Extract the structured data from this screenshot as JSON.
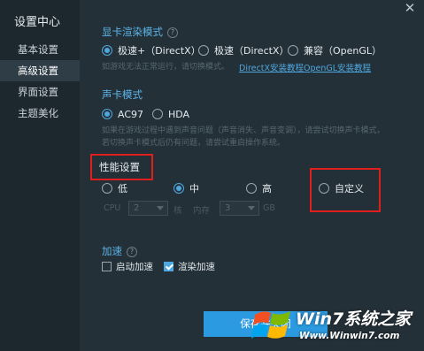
{
  "sidebar": {
    "title": "设置中心",
    "items": [
      {
        "label": "基本设置"
      },
      {
        "label": "高级设置"
      },
      {
        "label": "界面设置"
      },
      {
        "label": "主题美化"
      }
    ]
  },
  "gpu_mode": {
    "title": "显卡渲染模式",
    "options": [
      {
        "label": "极速+（DirectX）",
        "checked": true
      },
      {
        "label": "极速（DirectX）",
        "checked": false
      },
      {
        "label": "兼容（OpenGL）",
        "checked": false
      }
    ],
    "desc": "如游戏无法正常运行，请切换模式。",
    "link_directx": "DirectX安装教程",
    "link_opengl": "OpenGL安装教程"
  },
  "sound_mode": {
    "title": "声卡模式",
    "options": [
      {
        "label": "AC97",
        "checked": true
      },
      {
        "label": "HDA",
        "checked": false
      }
    ],
    "desc_line1": "如果在游戏过程中遇到声音问题（声音消失、声音变调），请尝试切换声卡模式，",
    "desc_line2": "若切换声卡模式后仍有问题，请尝试重启操作系统。"
  },
  "performance": {
    "title": "性能设置",
    "options": [
      {
        "label": "低",
        "checked": false
      },
      {
        "label": "中",
        "checked": true
      },
      {
        "label": "高",
        "checked": false
      },
      {
        "label": "自定义",
        "checked": false
      }
    ],
    "cpu_label": "CPU",
    "cpu_value": "2",
    "cpu_unit": "核",
    "mem_label": "内存",
    "mem_value": "3",
    "mem_unit": "GB"
  },
  "acceleration": {
    "title": "加速",
    "options": [
      {
        "label": "启动加速",
        "checked": false
      },
      {
        "label": "渲染加速",
        "checked": true
      }
    ]
  },
  "save_button": "保存并关闭",
  "watermark": {
    "line1": "Win7系统之家",
    "line2": "Www.Winwin7.com"
  },
  "colors": {
    "accent": "#4ea7de",
    "highlight": "#e01e1e",
    "background": "#243038"
  }
}
